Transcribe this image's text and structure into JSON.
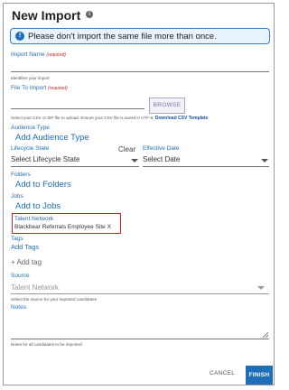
{
  "dialog": {
    "title": "New Import",
    "info_glyph": "i"
  },
  "banner": {
    "icon": "!",
    "message": "Please don't import the same file more than once."
  },
  "import_name": {
    "label": "Import Name",
    "required": "(required)",
    "value": "",
    "hint": "Identifies your import"
  },
  "file": {
    "label": "File To Import",
    "required": "(required)",
    "browse_label": "BROWSE",
    "hint": "Select your CSV or ZIP file to upload. Ensure your CSV file is saved in UTF-8.",
    "template_link": "Download CSV Template"
  },
  "audience": {
    "label": "Audience Type",
    "link": "Add Audience Type"
  },
  "lifecycle": {
    "label": "Lifecycle State",
    "clear": "Clear",
    "selected": "Select Lifecycle State"
  },
  "effective_date": {
    "label": "Effective Date",
    "selected": "Select Date"
  },
  "folders": {
    "label": "Folders",
    "link": "Add to Folders"
  },
  "jobs": {
    "label": "Jobs",
    "link": "Add to Jobs"
  },
  "talent_network": {
    "label": "Talent Network",
    "value": "Blackbear Referrals Employee Site",
    "remove": "X"
  },
  "tags": {
    "label": "Tags",
    "link": "Add Tags",
    "add_placeholder": "+ Add tag"
  },
  "source": {
    "label": "Source",
    "placeholder": "Talent Network",
    "hint": "Select the source for your imported candidates"
  },
  "notes": {
    "label": "Notes",
    "value": "",
    "hint": "Notes for all candidates to be imported"
  },
  "footer": {
    "cancel": "CANCEL",
    "finish": "FINISH"
  },
  "colors": {
    "accent": "#1f6fb8",
    "required": "#c62828",
    "highlight": "#d32020"
  }
}
